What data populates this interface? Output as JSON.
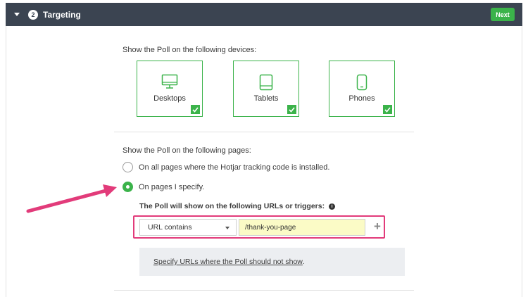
{
  "header": {
    "step_number": "2",
    "title": "Targeting",
    "next_label": "Next"
  },
  "devices": {
    "heading": "Show the Poll on the following devices:",
    "items": [
      {
        "label": "Desktops",
        "icon": "desktop-icon",
        "checked": true
      },
      {
        "label": "Tablets",
        "icon": "tablet-icon",
        "checked": true
      },
      {
        "label": "Phones",
        "icon": "phone-icon",
        "checked": true
      }
    ]
  },
  "pages": {
    "heading": "Show the Poll on the following pages:",
    "options": [
      {
        "label": "On all pages where the Hotjar tracking code is installed.",
        "selected": false
      },
      {
        "label": "On pages I specify.",
        "selected": true
      }
    ]
  },
  "urls": {
    "label": "The Poll will show on the following URLs or triggers:",
    "info_icon": "info-icon",
    "rule_type": "URL contains",
    "rule_value": "/thank-you-page",
    "add_icon": "plus-icon"
  },
  "exclude": {
    "link_text": "Specify URLs where the Poll should not show",
    "suffix": "."
  },
  "colors": {
    "header_bg": "#3b4451",
    "accent_green": "#3bb34a",
    "annotation_pink": "#e23b7a",
    "input_highlight": "#fbfbc6"
  }
}
